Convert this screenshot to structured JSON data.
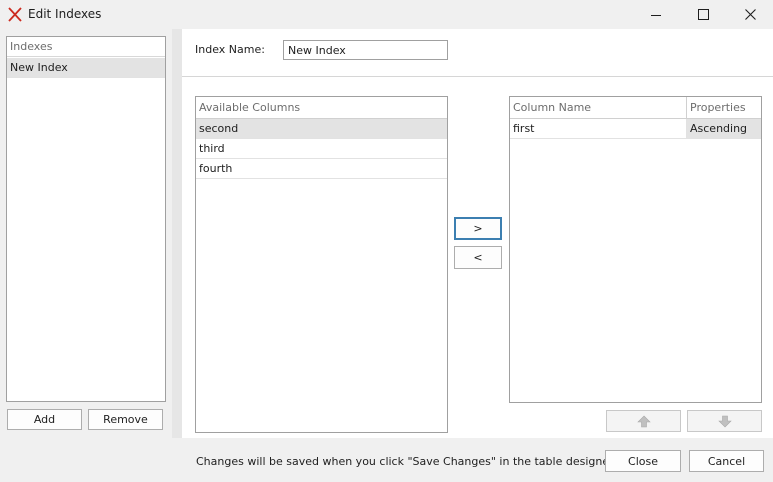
{
  "window": {
    "title": "Edit Indexes",
    "icon": "x-logo-icon",
    "controls": [
      "minimize-icon",
      "maximize-icon",
      "close-icon"
    ]
  },
  "indexes_panel": {
    "header": "Indexes",
    "items": [
      {
        "label": "New Index",
        "selected": true
      }
    ],
    "add_label": "Add",
    "remove_label": "Remove"
  },
  "index_name": {
    "label": "Index Name:",
    "value": "New Index"
  },
  "available_columns": {
    "header": "Available Columns",
    "rows": [
      {
        "label": "second",
        "selected": true
      },
      {
        "label": "third",
        "selected": false
      },
      {
        "label": "fourth",
        "selected": false
      }
    ]
  },
  "transfer_buttons": {
    "add_label": ">",
    "remove_label": "<"
  },
  "index_columns": {
    "headers": {
      "name": "Column Name",
      "properties": "Properties"
    },
    "rows": [
      {
        "name": "first",
        "properties": "Ascending"
      }
    ]
  },
  "order_buttons": {
    "up_icon": "arrow-up-icon",
    "down_icon": "arrow-down-icon"
  },
  "footer": {
    "message": "Changes will be saved when you click \"Save Changes\" in the table designer.",
    "close_label": "Close",
    "cancel_label": "Cancel"
  }
}
